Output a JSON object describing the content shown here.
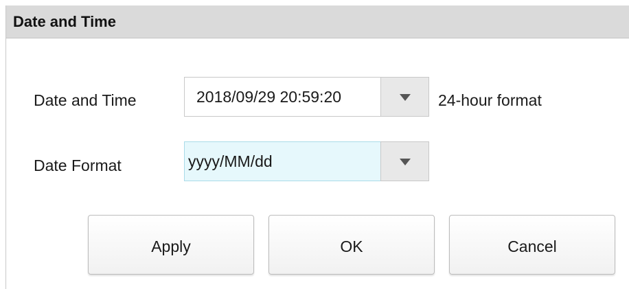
{
  "dialog": {
    "title": "Date and Time"
  },
  "datetime": {
    "label": "Date and Time",
    "value": "2018/09/29 20:59:20",
    "note": "24-hour format",
    "arrow_icon": "triangle-down-icon"
  },
  "date_format": {
    "label": "Date Format",
    "value": "yyyy/MM/dd",
    "arrow_icon": "triangle-down-icon",
    "highlight_color": "#e6f8fc"
  },
  "buttons": {
    "apply": "Apply",
    "ok": "OK",
    "cancel": "Cancel"
  }
}
